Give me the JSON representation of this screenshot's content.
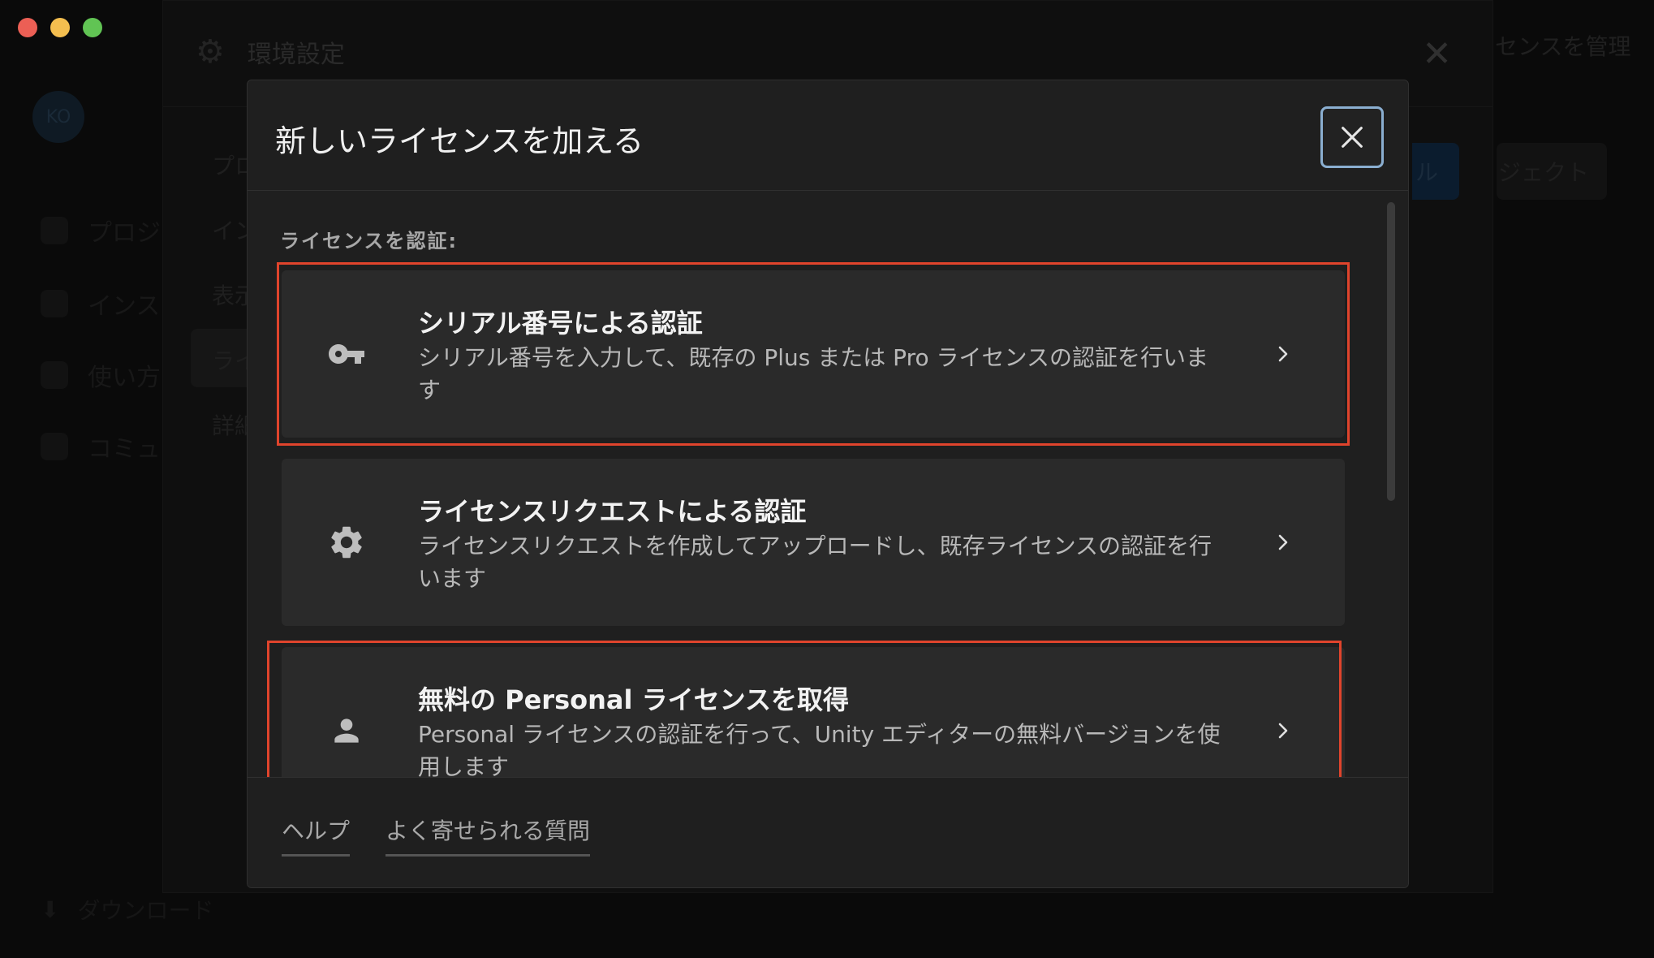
{
  "window": {
    "traffic_lights": [
      "close",
      "minimize",
      "zoom"
    ],
    "colors": {
      "red": "#ec5f55",
      "yellow": "#f4be4f",
      "green": "#61c454"
    }
  },
  "background": {
    "avatar_initials": "KO",
    "sidebar_items": [
      {
        "label": "プロジ",
        "icon": "cube-icon"
      },
      {
        "label": "インス",
        "icon": "lock-icon"
      },
      {
        "label": "使い方",
        "icon": "graduation-cap-icon"
      },
      {
        "label": "コミュ",
        "icon": "people-icon"
      }
    ],
    "download_label": "ダウンロード",
    "preferences": {
      "title": "環境設定",
      "nav_items": [
        "プロ",
        "イン",
        "表示",
        "ライ",
        "詳細"
      ],
      "active_nav_index": 3
    },
    "right_header_text": "センスを管理",
    "right_button_1": "ル",
    "right_button_2": "ジェクト"
  },
  "modal": {
    "title": "新しいライセンスを加える",
    "close_label": "✕",
    "section_label": "ライセンスを認証:",
    "options": [
      {
        "title": "シリアル番号による認証",
        "description": "シリアル番号を入力して、既存の Plus または Pro ライセンスの認証を行いま す",
        "icon": "key-icon",
        "highlighted": true
      },
      {
        "title": "ライセンスリクエストによる認証",
        "description": "ライセンスリクエストを作成してアップロードし、既存ライセンスの認証を行 います",
        "icon": "gear-icon",
        "highlighted": false
      },
      {
        "title": "無料の Personal ライセンスを取得",
        "description": "Personal ライセンスの認証を行って、Unity エディターの無料バージョンを使 用します",
        "icon": "person-icon",
        "highlighted": true
      }
    ],
    "footer_links": [
      "ヘルプ",
      "よく寄せられる質問"
    ]
  },
  "colors": {
    "highlight": "#e0442c",
    "close_focus": "#8aaed0",
    "modal_bg": "#1f1f1f",
    "option_bg": "#2a2a2a"
  }
}
